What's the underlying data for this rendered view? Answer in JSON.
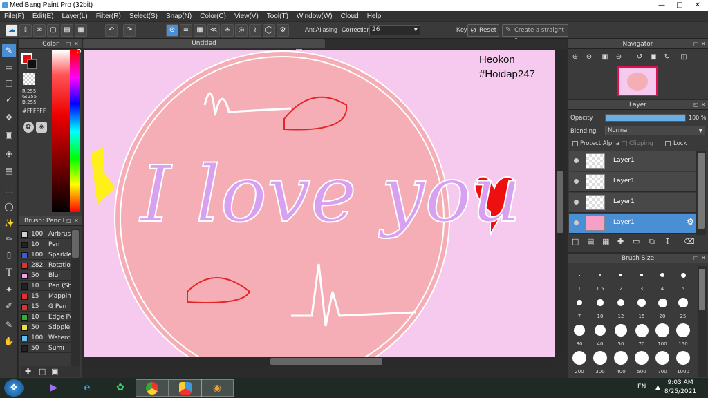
{
  "window": {
    "title": "MediBang Paint Pro (32bit)"
  },
  "menu": [
    "File(F)",
    "Edit(E)",
    "Layer(L)",
    "Filter(R)",
    "Select(S)",
    "Snap(N)",
    "Color(C)",
    "View(V)",
    "Tool(T)",
    "Window(W)",
    "Cloud",
    "Help"
  ],
  "toolbar": {
    "antialiasing": "AntiAliasing",
    "correction_label": "Correction",
    "correction_value": "26",
    "key_label": "Key",
    "reset": "Reset",
    "straight_line": "Create a straight line"
  },
  "color_panel": {
    "title": "Color",
    "r": "R:255",
    "g": "G:255",
    "b": "B:255",
    "hex": "#FFFFFF"
  },
  "brush_panel": {
    "title": "Brush: Pencil",
    "brushes": [
      {
        "size": "100",
        "name": "Airbrush",
        "color": "#d0d0d0"
      },
      {
        "size": "10",
        "name": "Pen",
        "color": "#222222"
      },
      {
        "size": "100",
        "name": "Sparkle",
        "color": "#3b5bd6"
      },
      {
        "size": "282",
        "name": "Rotation",
        "color": "#e03030"
      },
      {
        "size": "50",
        "name": "Blur",
        "color": "#f0a0e8"
      },
      {
        "size": "10",
        "name": "Pen (Sh",
        "color": "#222222"
      },
      {
        "size": "15",
        "name": "Mapping",
        "color": "#e03030"
      },
      {
        "size": "15",
        "name": "G Pen",
        "color": "#e03030"
      },
      {
        "size": "10",
        "name": "Edge Pe",
        "color": "#30b030"
      },
      {
        "size": "50",
        "name": "Stipple I",
        "color": "#f0e030"
      },
      {
        "size": "100",
        "name": "Waterco",
        "color": "#60c0f0"
      },
      {
        "size": "50",
        "name": "Sumi",
        "color": "#222222"
      }
    ]
  },
  "canvas": {
    "tab": "Untitled",
    "watermark_line1": "Heokon",
    "watermark_line2": "#Hoidap247",
    "artwork_text": "I love you",
    "colors": {
      "background": "#f6c9ee",
      "circle": "#f5aeb6",
      "text": "#d8a0f0",
      "heart": "#ee1010"
    }
  },
  "navigator": {
    "title": "Navigator"
  },
  "layer_panel": {
    "title": "Layer",
    "opacity_label": "Opacity",
    "opacity_value": "100 %",
    "opacity_fraction": 1.0,
    "blending_label": "Blending",
    "blending_value": "Normal",
    "protect_alpha": "Protect Alpha",
    "clipping": "Clipping",
    "lock": "Lock",
    "layers": [
      {
        "name": "Layer1",
        "selected": false
      },
      {
        "name": "Layer1",
        "selected": false
      },
      {
        "name": "Layer1",
        "selected": false
      },
      {
        "name": "Layer1",
        "selected": true
      }
    ]
  },
  "brush_size": {
    "title": "Brush Size",
    "rows": [
      [
        "1",
        "1.5",
        "2",
        "3",
        "4",
        "5"
      ],
      [
        "7",
        "10",
        "12",
        "15",
        "20",
        "25"
      ],
      [
        "30",
        "40",
        "50",
        "70",
        "100",
        "150"
      ],
      [
        "200",
        "300",
        "400",
        "500",
        "700",
        "1000"
      ]
    ]
  },
  "taskbar": {
    "lang": "EN",
    "time": "9:03 AM",
    "date": "8/25/2021"
  }
}
